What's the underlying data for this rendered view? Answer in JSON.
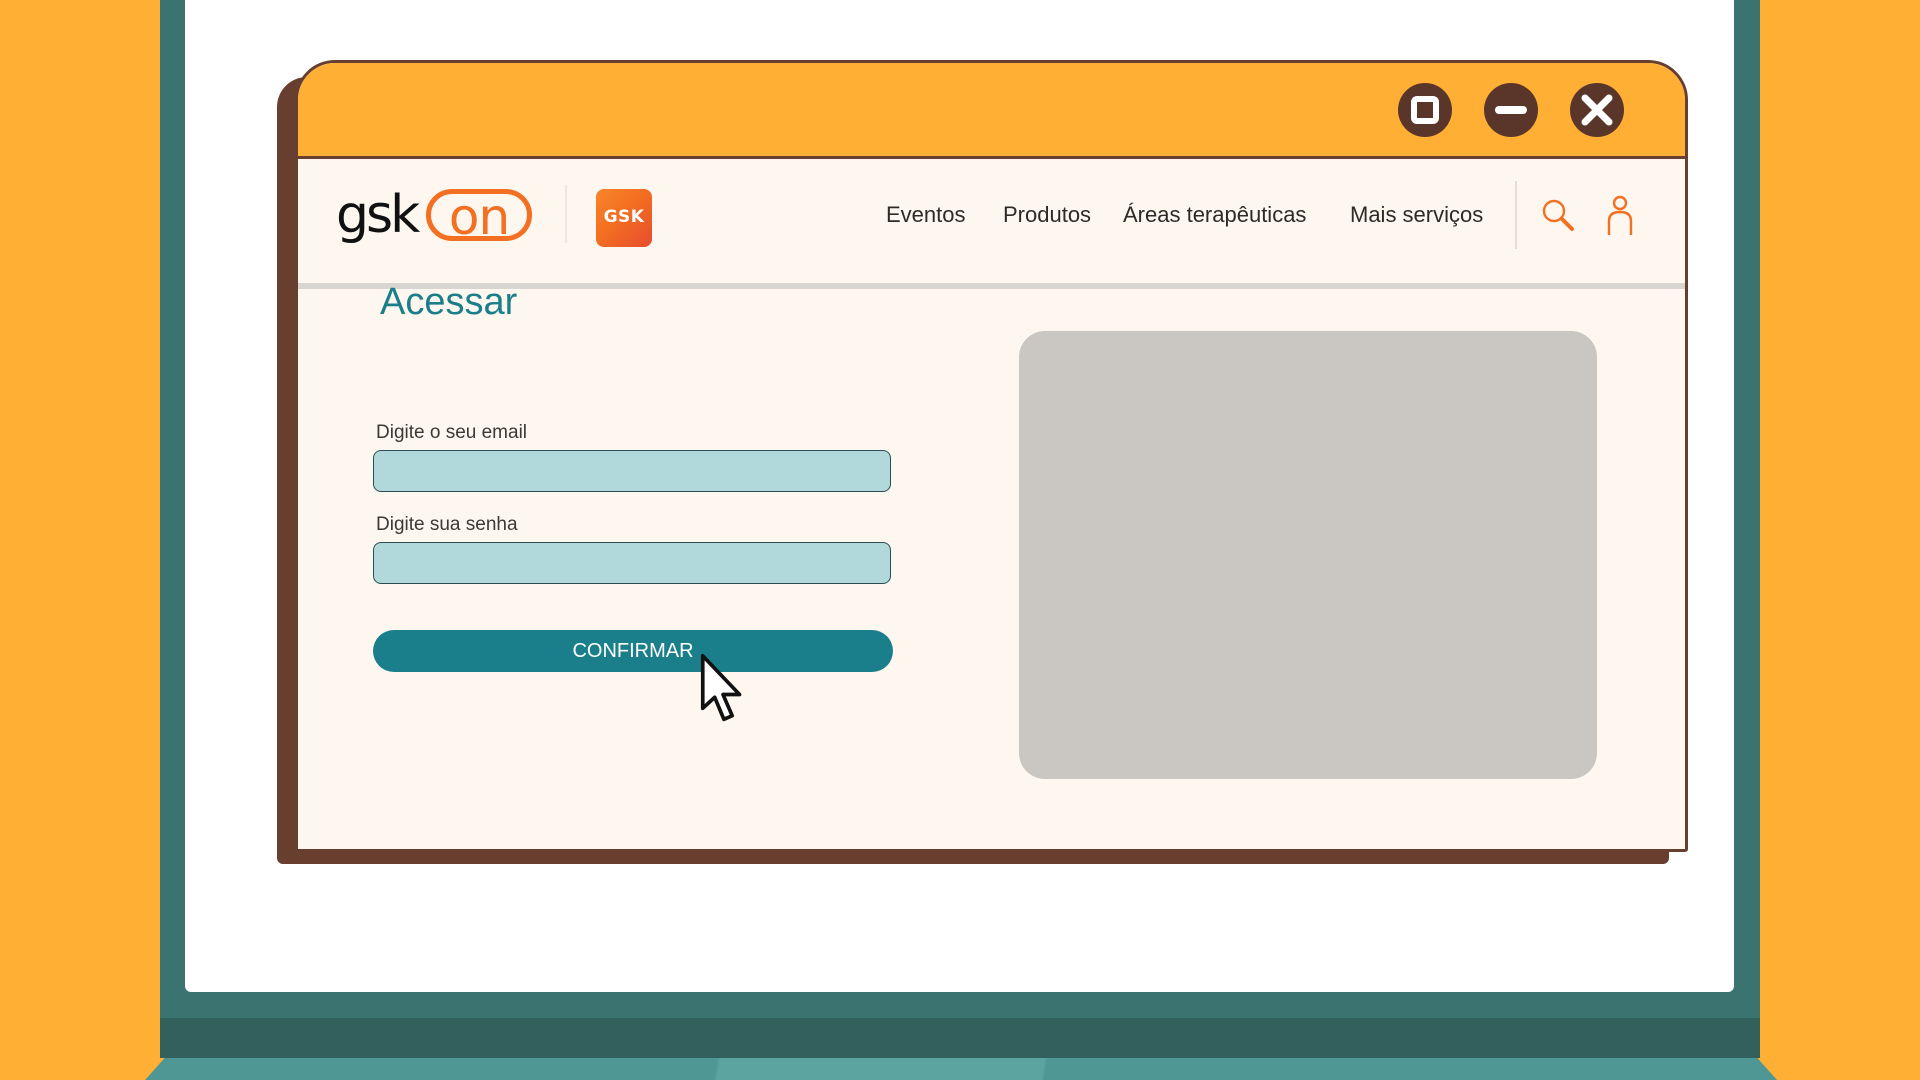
{
  "colors": {
    "background": "#FFAF34",
    "titlebar": "#FFAF34",
    "window_border": "#683F2E",
    "accent": "#1B7E8B",
    "input_fill": "#B1D8DB",
    "brand_orange": "#F36F21",
    "placeholder_gray": "#CAC7C2"
  },
  "window": {
    "controls": [
      {
        "name": "maximize",
        "icon": "maximize-icon"
      },
      {
        "name": "minimize",
        "icon": "minimize-icon"
      },
      {
        "name": "close",
        "icon": "close-icon"
      }
    ]
  },
  "header": {
    "logo_text_left": "gsk",
    "logo_text_right": "on",
    "brand_badge": "GSK",
    "nav": {
      "eventos": "Eventos",
      "produtos": "Produtos",
      "areas": "Áreas terapêuticas",
      "mais": "Mais serviços"
    },
    "icons": [
      "search-icon",
      "user-icon"
    ]
  },
  "login": {
    "title": "Acessar",
    "email_label": "Digite o seu email",
    "email_value": "",
    "password_label": "Digite sua senha",
    "password_value": "",
    "confirm_label": "CONFIRMAR"
  }
}
